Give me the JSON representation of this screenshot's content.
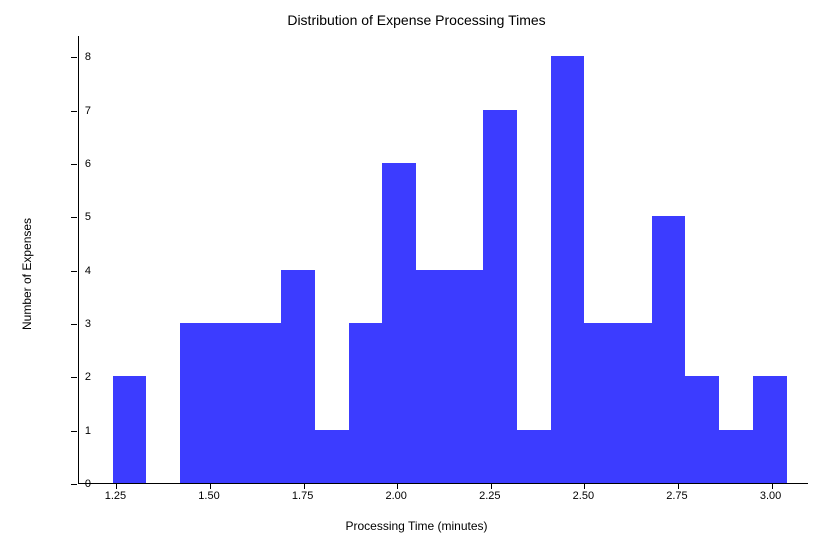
{
  "chart_data": {
    "type": "bar",
    "title": "Distribution of Expense Processing Times",
    "xlabel": "Processing Time (minutes)",
    "ylabel": "Number of Expenses",
    "xlim": [
      1.15,
      3.1
    ],
    "ylim": [
      0,
      8.4
    ],
    "x_ticks": [
      "1.25",
      "1.50",
      "1.75",
      "2.00",
      "2.25",
      "2.50",
      "2.75",
      "3.00"
    ],
    "x_tick_values": [
      1.25,
      1.5,
      1.75,
      2.0,
      2.25,
      2.5,
      2.75,
      3.0
    ],
    "y_ticks": [
      "0",
      "1",
      "2",
      "3",
      "4",
      "5",
      "6",
      "7",
      "8"
    ],
    "y_tick_values": [
      0,
      1,
      2,
      3,
      4,
      5,
      6,
      7,
      8
    ],
    "bin_edges": [
      1.24,
      1.33,
      1.42,
      1.51,
      1.6,
      1.69,
      1.78,
      1.87,
      1.96,
      2.05,
      2.14,
      2.23,
      2.32,
      2.41,
      2.5,
      2.59,
      2.68,
      2.77,
      2.86,
      2.95,
      3.04
    ],
    "values": [
      2,
      0,
      3,
      3,
      3,
      4,
      1,
      3,
      6,
      4,
      4,
      7,
      1,
      8,
      3,
      3,
      5,
      2,
      1,
      2
    ]
  }
}
